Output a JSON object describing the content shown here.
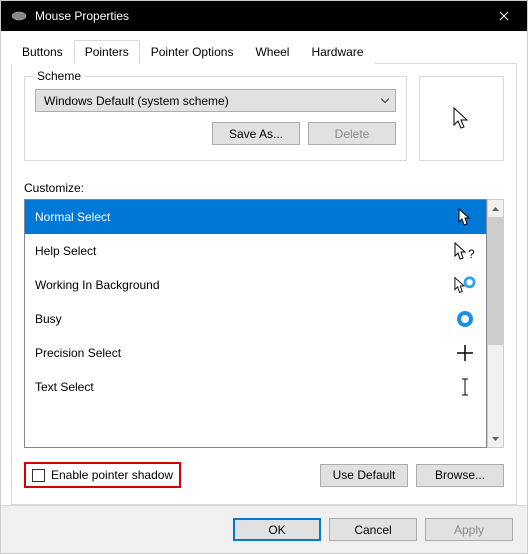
{
  "window": {
    "title": "Mouse Properties"
  },
  "tabs": [
    "Buttons",
    "Pointers",
    "Pointer Options",
    "Wheel",
    "Hardware"
  ],
  "activeTab": 1,
  "scheme": {
    "legend": "Scheme",
    "selected": "Windows Default (system scheme)",
    "saveAs": "Save As...",
    "delete": "Delete"
  },
  "customizeLabel": "Customize:",
  "cursors": [
    {
      "label": "Normal Select",
      "selected": true,
      "icon": "arrow-white"
    },
    {
      "label": "Help Select",
      "selected": false,
      "icon": "arrow-help"
    },
    {
      "label": "Working In Background",
      "selected": false,
      "icon": "arrow-ring"
    },
    {
      "label": "Busy",
      "selected": false,
      "icon": "ring"
    },
    {
      "label": "Precision Select",
      "selected": false,
      "icon": "cross"
    },
    {
      "label": "Text Select",
      "selected": false,
      "icon": "ibeam"
    }
  ],
  "enableShadow": {
    "label": "Enable pointer shadow",
    "checked": false
  },
  "useDefault": "Use Default",
  "browse": "Browse...",
  "footer": {
    "ok": "OK",
    "cancel": "Cancel",
    "apply": "Apply"
  }
}
